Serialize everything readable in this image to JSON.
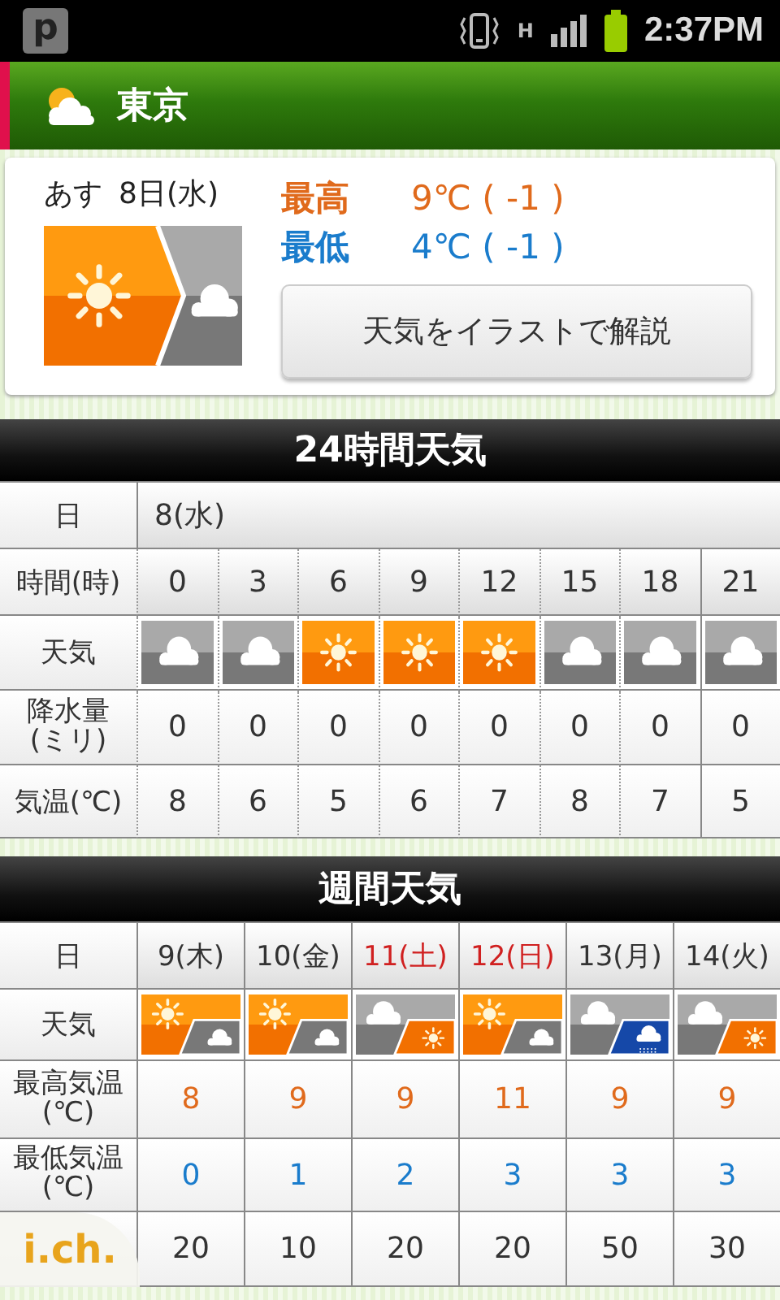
{
  "status_bar": {
    "notification": "p",
    "network": "H",
    "time": "2:37PM"
  },
  "header": {
    "city": "東京"
  },
  "forecast": {
    "day_label": "あす",
    "date": "8日(水)",
    "icon": [
      {
        "kind": "sun"
      },
      {
        "kind": "cloud"
      }
    ],
    "high_label": "最高",
    "high": "9℃ (  -1  )",
    "low_label": "最低",
    "low": "4℃ (  -1  )",
    "button": "天気をイラストで解説"
  },
  "hourly": {
    "title": "24時間天気",
    "date_label": "日",
    "date": "8(水)",
    "time_label": "時間(時)",
    "weather_label": "天気",
    "rain_label": "降水量\n(ミリ)",
    "temp_label": "気温(℃)",
    "columns": [
      {
        "time": "0",
        "kind": "cloud",
        "rain": "0",
        "temp": "8"
      },
      {
        "time": "3",
        "kind": "cloud",
        "rain": "0",
        "temp": "6"
      },
      {
        "time": "6",
        "kind": "sun",
        "rain": "0",
        "temp": "5"
      },
      {
        "time": "9",
        "kind": "sun",
        "rain": "0",
        "temp": "6"
      },
      {
        "time": "12",
        "kind": "sun",
        "rain": "0",
        "temp": "7"
      },
      {
        "time": "15",
        "kind": "cloud",
        "rain": "0",
        "temp": "8"
      },
      {
        "time": "18",
        "kind": "cloud",
        "rain": "0",
        "temp": "7"
      },
      {
        "time": "21",
        "kind": "cloud",
        "rain": "0",
        "temp": "5"
      }
    ]
  },
  "weekly": {
    "title": "週間天気",
    "date_label": "日",
    "weather_label": "天気",
    "high_label": "最高気温\n(℃)",
    "low_label": "最低気温\n(℃)",
    "days": [
      {
        "date": "9(木)",
        "weekend": false,
        "icon": [
          {
            "kind": "sun"
          },
          {
            "kind": "cloud"
          }
        ],
        "high": "8",
        "low": "0",
        "rain": "20"
      },
      {
        "date": "10(金)",
        "weekend": false,
        "icon": [
          {
            "kind": "sun"
          },
          {
            "kind": "cloud"
          }
        ],
        "high": "9",
        "low": "1",
        "rain": "10"
      },
      {
        "date": "11(土)",
        "weekend": true,
        "icon": [
          {
            "kind": "cloud"
          },
          {
            "kind": "sun"
          }
        ],
        "high": "9",
        "low": "2",
        "rain": "20"
      },
      {
        "date": "12(日)",
        "weekend": true,
        "icon": [
          {
            "kind": "sun"
          },
          {
            "kind": "cloud"
          }
        ],
        "high": "11",
        "low": "3",
        "rain": "20"
      },
      {
        "date": "13(月)",
        "weekend": false,
        "icon": [
          {
            "kind": "cloud"
          },
          {
            "kind": "rain"
          }
        ],
        "high": "9",
        "low": "3",
        "rain": "50"
      },
      {
        "date": "14(火)",
        "weekend": false,
        "icon": [
          {
            "kind": "cloud"
          },
          {
            "kind": "sun"
          }
        ],
        "high": "9",
        "low": "3",
        "rain": "30"
      }
    ]
  },
  "overlay": {
    "logo": "i.ch."
  }
}
